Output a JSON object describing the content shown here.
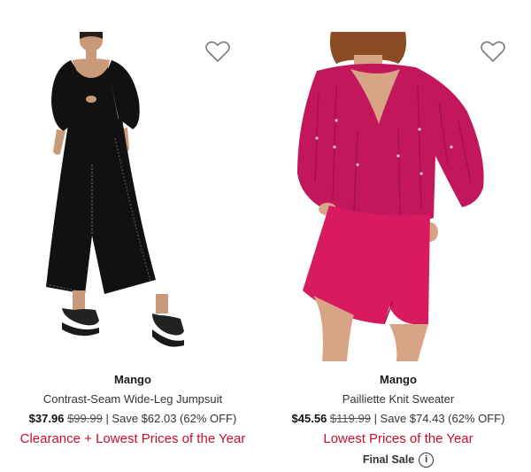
{
  "products": [
    {
      "brand": "Mango",
      "name": "Contrast-Seam Wide-Leg Jumpsuit",
      "price_now": "$37.96",
      "price_was": "$99.99",
      "savings": " | Save $62.03 (62% OFF)",
      "promo": "Clearance + Lowest Prices of the Year",
      "image_icon": "black-jumpsuit-photo",
      "favorite_icon": "heart-icon"
    },
    {
      "brand": "Mango",
      "name": "Pailliette Knit Sweater",
      "price_now": "$45.56",
      "price_was": "$119.99",
      "savings": " | Save $74.43 (62% OFF)",
      "promo": "Lowest Prices of the Year",
      "final_sale": "Final Sale",
      "info_glyph": "i",
      "image_icon": "pink-sweater-skirt-photo",
      "favorite_icon": "heart-icon"
    }
  ],
  "colors": {
    "promo_red": "#c8102e",
    "jumpsuit_black": "#111111",
    "sweater_pink": "#c2185b",
    "skirt_pink": "#d81b60"
  }
}
